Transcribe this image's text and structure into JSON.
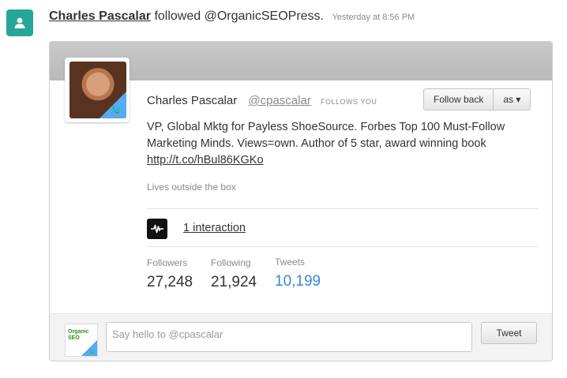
{
  "notification": {
    "icon": "person-icon",
    "actor": "Charles Pascalar",
    "action": "followed @OrganicSEOPress.",
    "time": "Yesterday at 8:56 PM"
  },
  "profile": {
    "name": "Charles Pascalar",
    "handle": "@cpascalar",
    "follows_you": "FOLLOWS YOU",
    "follow_back_label": "Follow back",
    "as_label": "as ▾",
    "bio_text": "VP, Global Mktg for Payless ShoeSource. Forbes Top 100 Must-Follow Marketing Minds. Views=own. Author of 5 star, award winning book",
    "bio_link": "http://t.co/hBul86KGKo",
    "location": "Lives outside the box",
    "interactions": "1 interaction",
    "stats": {
      "followers_label": "Followers",
      "followers_value": "27,248",
      "following_label": "Following",
      "following_value": "21,924",
      "tweets_label": "Tweets",
      "tweets_value": "10,199"
    }
  },
  "reply": {
    "avatar_logo": "Organic SEO",
    "placeholder": "Say hello to @cpascalar",
    "tweet_label": "Tweet"
  },
  "colors": {
    "accent_teal": "#26a69a",
    "twitter_blue": "#55acee",
    "tweets_count_blue": "#3b88d8"
  }
}
